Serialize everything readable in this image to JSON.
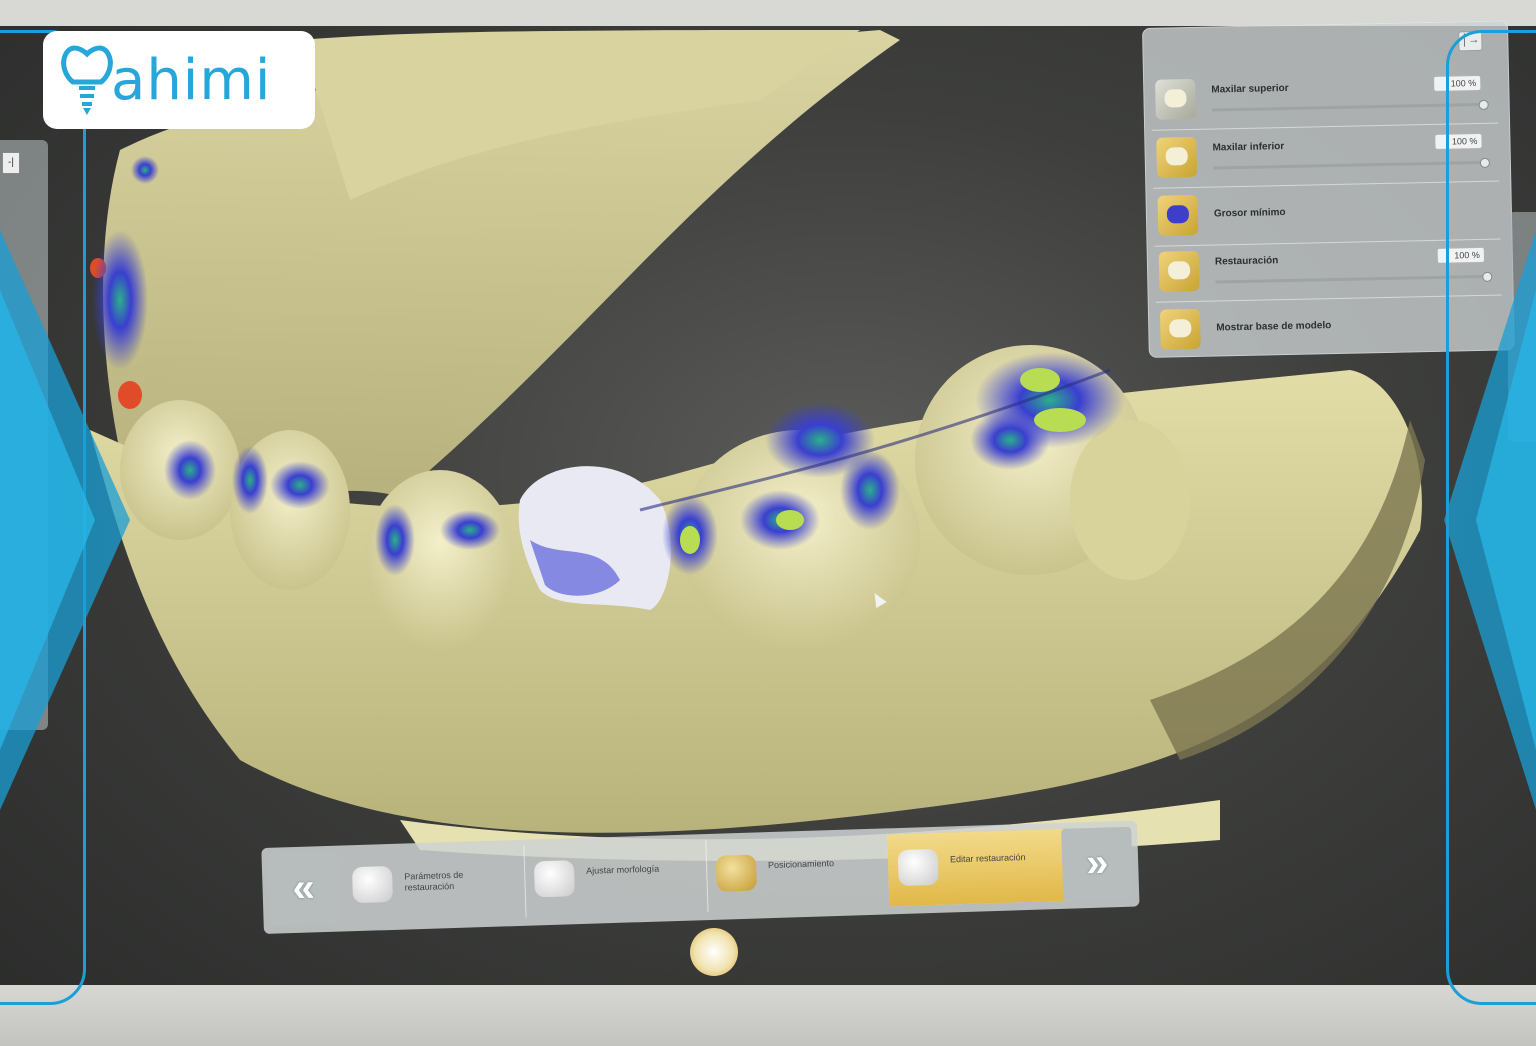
{
  "brand": {
    "logo_text": "ahimi",
    "accent": "#1aa0d6"
  },
  "viewer": {
    "model_color": "#e8e4b4",
    "contact_colors": [
      "#2a2fc8",
      "#35b38a",
      "#c3e34b",
      "#e04b2a"
    ],
    "left_panel_button": "-|"
  },
  "layer_panel": {
    "collapse_icon": "collapse-icon",
    "layers": [
      {
        "label": "Maxilar superior",
        "percent": "100 %",
        "thumb": "upper-jaw-icon"
      },
      {
        "label": "Maxilar inferior",
        "percent": "100 %",
        "thumb": "lower-jaw-icon"
      },
      {
        "label": "Grosor mínimo",
        "percent": "",
        "thumb": "thickness-icon"
      },
      {
        "label": "Restauración",
        "percent": "100 %",
        "thumb": "restoration-icon"
      },
      {
        "label": "Mostrar base de modelo",
        "percent": "",
        "thumb": "model-base-icon"
      }
    ]
  },
  "workflow": {
    "prev": "«",
    "next": "»",
    "steps": [
      {
        "label": "Parámetros de restauración",
        "active": false
      },
      {
        "label": "Ajustar morfología",
        "active": false
      },
      {
        "label": "Posicionamiento",
        "active": false
      },
      {
        "label": "Editar restauración",
        "active": true
      }
    ]
  }
}
